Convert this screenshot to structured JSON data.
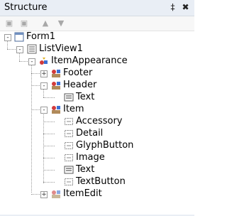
{
  "window": {
    "title": "Structure",
    "pin_glyph": "‡",
    "close_glyph": "✖"
  },
  "toolbar": {
    "buttons": [
      {
        "name": "add-item-icon",
        "glyph": "▣"
      },
      {
        "name": "delete-item-icon",
        "glyph": "▣"
      },
      {
        "name": "move-up-icon",
        "glyph": "▲"
      },
      {
        "name": "move-down-icon",
        "glyph": "▼"
      }
    ]
  },
  "tree": {
    "nodes": [
      {
        "label": "Form1",
        "icon": "form-icon",
        "expander": "-"
      },
      {
        "label": "ListView1",
        "icon": "listview-icon",
        "expander": "-"
      },
      {
        "label": "ItemAppearance",
        "icon": "appearance-icon",
        "expander": "-"
      },
      {
        "label": "Footer",
        "icon": "object-icon",
        "expander": "+"
      },
      {
        "label": "Header",
        "icon": "object-icon",
        "expander": "-"
      },
      {
        "label": "Text",
        "icon": "text-object-icon"
      },
      {
        "label": "Item",
        "icon": "object-icon",
        "expander": "-"
      },
      {
        "label": "Accessory",
        "icon": "object-placeholder-icon"
      },
      {
        "label": "Detail",
        "icon": "object-placeholder-icon"
      },
      {
        "label": "GlyphButton",
        "icon": "object-placeholder-icon"
      },
      {
        "label": "Image",
        "icon": "object-placeholder-icon"
      },
      {
        "label": "Text",
        "icon": "text-object-icon"
      },
      {
        "label": "TextButton",
        "icon": "object-placeholder-icon"
      },
      {
        "label": "ItemEdit",
        "icon": "object-icon",
        "expander": "+"
      }
    ]
  }
}
